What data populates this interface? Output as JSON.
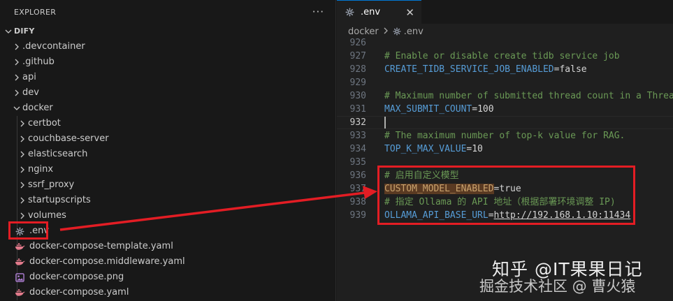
{
  "explorer": {
    "title": "EXPLORER",
    "more_label": "···",
    "root": "DIFY",
    "items": [
      {
        "label": ".devcontainer"
      },
      {
        "label": ".github"
      },
      {
        "label": "api"
      },
      {
        "label": "dev"
      },
      {
        "label": "docker"
      },
      {
        "label": "certbot"
      },
      {
        "label": "couchbase-server"
      },
      {
        "label": "elasticsearch"
      },
      {
        "label": "nginx"
      },
      {
        "label": "ssrf_proxy"
      },
      {
        "label": "startupscripts"
      },
      {
        "label": "volumes"
      },
      {
        "label": ".env"
      },
      {
        "label": "docker-compose-template.yaml"
      },
      {
        "label": "docker-compose.middleware.yaml"
      },
      {
        "label": "docker-compose.png"
      },
      {
        "label": "docker-compose.yaml"
      }
    ]
  },
  "editor": {
    "tab_label": ".env",
    "close_glyph": "✕",
    "breadcrumb": {
      "folder": "docker",
      "file": ".env"
    },
    "lines": [
      {
        "num": "926",
        "parts": []
      },
      {
        "num": "927",
        "comment": "# Enable or disable create tidb service job"
      },
      {
        "num": "928",
        "key": "CREATE_TIDB_SERVICE_JOB_ENABLED",
        "value": "false"
      },
      {
        "num": "929",
        "parts": []
      },
      {
        "num": "930",
        "comment": "# Maximum number of submitted thread count in a ThreadPool"
      },
      {
        "num": "931",
        "key": "MAX_SUBMIT_COUNT",
        "value": "100"
      },
      {
        "num": "932",
        "parts": []
      },
      {
        "num": "933",
        "comment": "# The maximum number of top-k value for RAG."
      },
      {
        "num": "934",
        "key": "TOP_K_MAX_VALUE",
        "value": "10"
      },
      {
        "num": "935",
        "parts": []
      },
      {
        "num": "936",
        "comment": "# 启用自定义模型"
      },
      {
        "num": "937",
        "key": "CUSTOM_MODEL_ENABLED",
        "value": "true"
      },
      {
        "num": "938",
        "comment": "# 指定 Ollama 的 API 地址（根据部署环境调整 IP)"
      },
      {
        "num": "939",
        "key": "OLLAMA_API_BASE_URL",
        "value": "http://192.168.1.10:11434"
      }
    ],
    "equals": "="
  },
  "watermark": {
    "line1": "知乎 @IT果果日记",
    "line2": "掘金技术社区 @ 曹火猿"
  },
  "colors": {
    "annotation_red": "#e31d24",
    "comment_green": "#6a9955",
    "key_blue": "#569cd6",
    "tab_accent": "#0078d4"
  }
}
